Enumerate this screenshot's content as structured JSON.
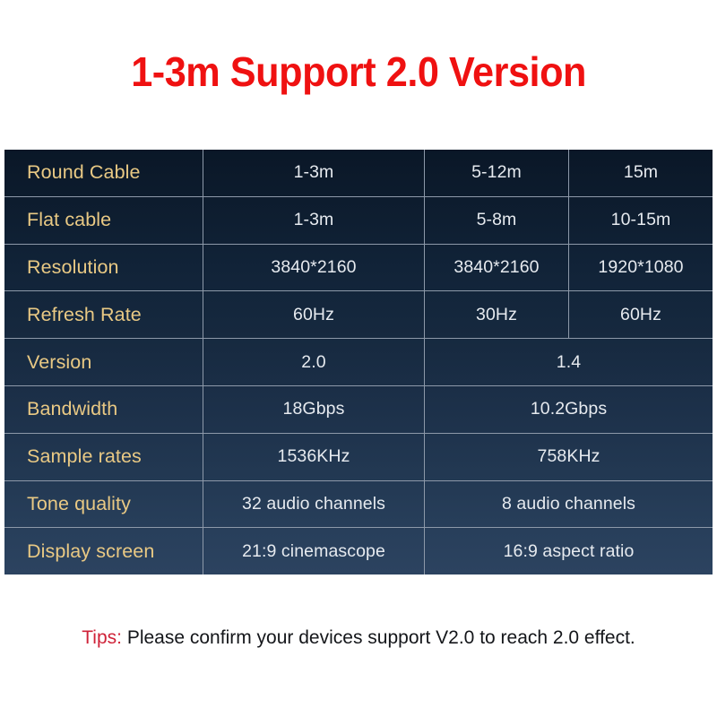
{
  "title": "1-3m Support 2.0 Version",
  "colors": {
    "title_red": "#ef1111",
    "label_gold": "#e9c984",
    "value_white": "#e6eaef",
    "table_top": "#0a1727",
    "table_bottom": "#2c4360",
    "grid_line": "#8d99a9",
    "tips_red": "#cf2238",
    "tips_text": "#14161a",
    "page_background": "#ffffff"
  },
  "table": {
    "rows": [
      {
        "label": "Round Cable",
        "split": 3,
        "values": [
          "1-3m",
          "5-12m",
          "15m"
        ]
      },
      {
        "label": "Flat cable",
        "split": 3,
        "values": [
          "1-3m",
          "5-8m",
          "10-15m"
        ]
      },
      {
        "label": "Resolution",
        "split": 3,
        "values": [
          "3840*2160",
          "3840*2160",
          "1920*1080"
        ]
      },
      {
        "label": "Refresh Rate",
        "split": 3,
        "values": [
          "60Hz",
          "30Hz",
          "60Hz"
        ]
      },
      {
        "label": "Version",
        "split": 2,
        "values": [
          "2.0",
          "1.4"
        ]
      },
      {
        "label": "Bandwidth",
        "split": 2,
        "values": [
          "18Gbps",
          "10.2Gbps"
        ]
      },
      {
        "label": "Sample rates",
        "split": 2,
        "values": [
          "1536KHz",
          "758KHz"
        ]
      },
      {
        "label": "Tone quality",
        "split": 2,
        "values": [
          "32 audio channels",
          "8 audio channels"
        ]
      },
      {
        "label": "Display screen",
        "split": 2,
        "values": [
          "21:9 cinemascope",
          "16:9 aspect ratio"
        ]
      }
    ]
  },
  "tips": {
    "label": "Tips:",
    "text": "Please confirm your devices support V2.0 to reach 2.0 effect."
  }
}
